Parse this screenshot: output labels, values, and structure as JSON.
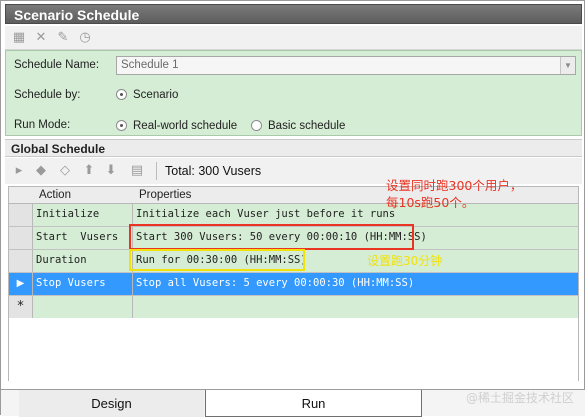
{
  "window": {
    "title": "Scenario Schedule"
  },
  "toolbar": {
    "icons": [
      "new-schedule-icon",
      "delete-icon",
      "rename-icon",
      "schedule-properties-icon"
    ]
  },
  "settings": {
    "schedule_name_label": "Schedule Name:",
    "schedule_name_value": "Schedule 1",
    "schedule_by_label": "Schedule by:",
    "schedule_by_option": "Scenario",
    "run_mode_label": "Run Mode:",
    "run_mode_options": [
      {
        "label": "Real-world schedule",
        "selected": true
      },
      {
        "label": "Basic schedule",
        "selected": false
      }
    ]
  },
  "global_schedule": {
    "title": "Global Schedule",
    "toolbar_icons": [
      "edit-action-icon",
      "add-action-icon",
      "remove-action-icon",
      "move-up-icon",
      "move-down-icon",
      "view-icon"
    ],
    "total_label": "Total: 300 Vusers",
    "columns": [
      "Action",
      "Properties"
    ],
    "rows": [
      {
        "action": "Initialize",
        "properties": "Initialize each Vuser just before it runs",
        "selected": false
      },
      {
        "action": "Start  Vusers",
        "properties": "Start 300 Vusers: 50 every 00:00:10 (HH:MM:SS)",
        "selected": false
      },
      {
        "action": "Duration",
        "properties": "Run for 00:30:00 (HH:MM:SS)",
        "selected": false
      },
      {
        "action": "Stop Vusers",
        "properties": "Stop all Vusers: 5 every 00:00:30 (HH:MM:SS)",
        "selected": true
      }
    ],
    "new_row_marker": "*"
  },
  "annotations": {
    "red_note": "设置同时跑300个用户，\n每10s跑50个。",
    "yellow_note": "设置跑30分钟",
    "watermark": "@稀土掘金技术社区",
    "colors": {
      "red": "#ea3323",
      "yellow": "#f1e20c",
      "selected_row": "#3399ff",
      "panel_green": "#d5ecd5"
    }
  },
  "tabs": [
    {
      "label": "Design",
      "active": false
    },
    {
      "label": "Run",
      "active": true
    }
  ]
}
